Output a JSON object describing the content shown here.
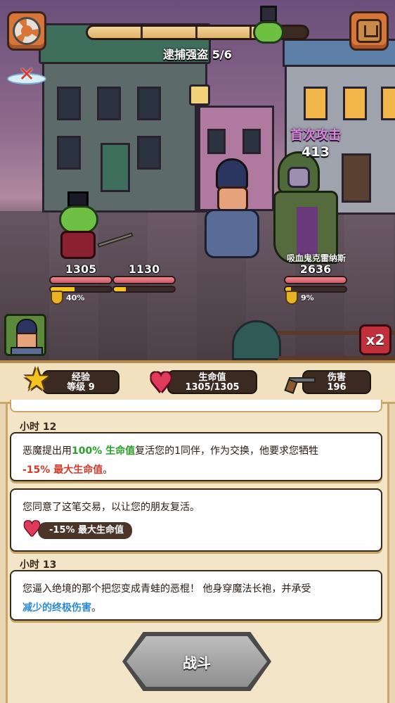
{
  "top": {
    "quest_label": "逮捕强盗 5/6",
    "progress": 0.83
  },
  "battle": {
    "first_attack": "首次攻击",
    "damage": "413",
    "enemy_name": "吸血鬼克雷纳斯",
    "player_hp": "1305",
    "ally_hp": "1130",
    "enemy_hp": "2636",
    "player_armor_pct": "40%",
    "enemy_armor_pct": "9%",
    "speed_label": "x2"
  },
  "stats": {
    "xp_label": "经验",
    "level_label": "等级 9",
    "hp_label": "生命值",
    "hp_value": "1305/1305",
    "damage_label": "伤害",
    "damage_value": "196"
  },
  "log": {
    "hour12": "小时 12",
    "card1": {
      "t1": "恶魔提出用",
      "g": "100% 生命值",
      "t2": "复活您的1同伴，作为交换，他要求您牺牲",
      "r": "-15% 最大生命值",
      "t3": "。"
    },
    "card2": {
      "text": "您同意了这笔交易，以让您的朋友复活。",
      "effect": "-15% 最大生命值"
    },
    "hour13": "小时 13",
    "card3": {
      "t1": "您逼入绝境的那个把您变成青蛙的恶棍！ 他身穿魔法长袍，并承受",
      "b": "减少的终极伤害",
      "t2": "。"
    },
    "fight_button": "战斗"
  },
  "colors": {
    "accent_green": "#28a028",
    "accent_red": "#d23a2a",
    "accent_blue": "#2a8ad8"
  }
}
